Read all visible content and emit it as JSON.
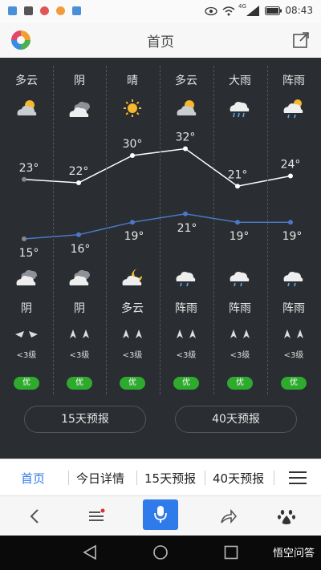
{
  "status_bar": {
    "time": "08:43",
    "network": "4G",
    "battery": ""
  },
  "header": {
    "title": "首页"
  },
  "days": [
    {
      "weather_day": "多云",
      "weather_night": "阴",
      "high": "23°",
      "low": "15°",
      "wind_level": "<3级",
      "aqi": "优",
      "icon_day": "cloudy-sun-icon",
      "icon_night": "overcast-icon"
    },
    {
      "weather_day": "阴",
      "weather_night": "阴",
      "high": "22°",
      "low": "16°",
      "wind_level": "<3级",
      "aqi": "优",
      "icon_day": "overcast-icon",
      "icon_night": "overcast-icon"
    },
    {
      "weather_day": "晴",
      "weather_night": "多云",
      "high": "30°",
      "low": "19°",
      "wind_level": "<3级",
      "aqi": "优",
      "icon_day": "sun-icon",
      "icon_night": "cloudy-moon-icon"
    },
    {
      "weather_day": "多云",
      "weather_night": "阵雨",
      "high": "32°",
      "low": "21°",
      "wind_level": "<3级",
      "aqi": "优",
      "icon_day": "cloudy-sun-icon",
      "icon_night": "shower-icon"
    },
    {
      "weather_day": "大雨",
      "weather_night": "阵雨",
      "high": "21°",
      "low": "19°",
      "wind_level": "<3级",
      "aqi": "优",
      "icon_day": "heavy-rain-icon",
      "icon_night": "shower-icon"
    },
    {
      "weather_day": "阵雨",
      "weather_night": "阵雨",
      "high": "24°",
      "low": "19°",
      "wind_level": "<3级",
      "aqi": "优",
      "icon_day": "shower-sun-icon",
      "icon_night": "shower-icon"
    }
  ],
  "chart_data": {
    "type": "line",
    "categories": [
      "多云",
      "阴",
      "晴",
      "多云",
      "大雨",
      "阵雨"
    ],
    "series": [
      {
        "values": [
          23,
          22,
          30,
          32,
          21,
          24
        ],
        "color": "#ffffff"
      },
      {
        "values": [
          15,
          16,
          19,
          21,
          19,
          19
        ],
        "color": "#4a78c8"
      }
    ]
  },
  "buttons": {
    "forecast_15": "15天预报",
    "forecast_40": "40天预报"
  },
  "tabs": [
    "首页",
    "今日详情",
    "15天预报",
    "40天预报"
  ],
  "watermark": "悟空问答",
  "colors": {
    "panel_bg": "#2a2d31",
    "aqi_good": "#2eaa2e",
    "accent": "#2f7bea",
    "low_line": "#4a78c8"
  }
}
